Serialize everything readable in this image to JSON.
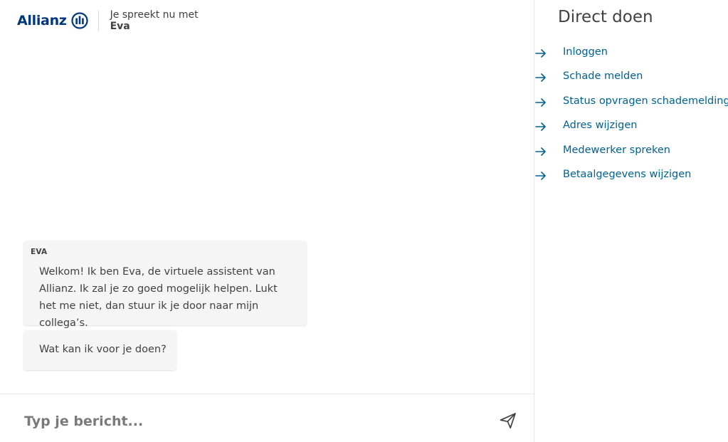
{
  "header": {
    "logo_text": "Allianz",
    "subtitle": "Je spreekt nu met",
    "agent_name": "Eva"
  },
  "chat": {
    "messages": [
      {
        "sender": "EVA",
        "text": "Welkom! Ik ben Eva, de virtuele assistent van Allianz. Ik zal je zo goed mogelijk helpen. Lukt het me niet, dan stuur ik je door naar mijn collega’s."
      },
      {
        "text": "Wat kan ik voor je doen?"
      }
    ]
  },
  "composer": {
    "placeholder": "Typ je bericht...",
    "send_icon": "send-icon"
  },
  "sidebar": {
    "title": "Direct doen",
    "actions": [
      {
        "label": "Inloggen"
      },
      {
        "label": "Schade melden"
      },
      {
        "label": "Status opvragen schademelding"
      },
      {
        "label": "Adres wijzigen"
      },
      {
        "label": "Medewerker spreken"
      },
      {
        "label": "Betaalgegevens wijzigen"
      }
    ]
  },
  "colors": {
    "brand": "#003781",
    "link": "#006192",
    "bubble": "#f5f5f5",
    "text": "#414141"
  }
}
